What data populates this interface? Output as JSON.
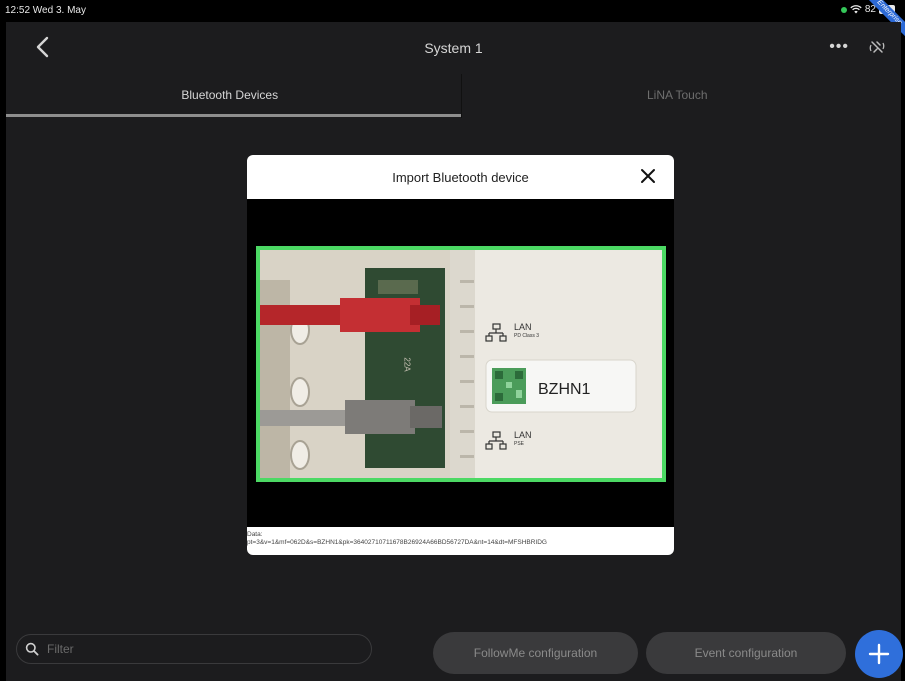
{
  "status_bar": {
    "time": "12:52  Wed 3. May",
    "battery_percent": "82",
    "ribbon_text": "Enterprise"
  },
  "nav": {
    "title": "System 1",
    "more_label": "•••"
  },
  "tabs": [
    {
      "label": "Bluetooth Devices",
      "active": true
    },
    {
      "label": "LiNA Touch",
      "active": false
    }
  ],
  "dialog": {
    "title": "Import Bluetooth device",
    "close_label": "✕",
    "scan_data_label": "Data:",
    "scan_data_value": "pt=3&v=1&mf=062D&s=BZHN1&pk=36402710711678B26924A66BD56727DA&nt=14&dt=MFSHBRIDG",
    "device_label_text": "BZHN1",
    "port_lan_top": "LAN",
    "port_lan_top_sub": "PD Class 3",
    "port_lan_bottom": "LAN",
    "port_lan_bottom_sub": "PSE",
    "port_side_mark": "22A"
  },
  "bottom_bar": {
    "filter_placeholder": "Filter",
    "followme_label": "FollowMe configuration",
    "event_label": "Event configuration",
    "fab_label": "+"
  },
  "colors": {
    "accent": "#2f6fdb",
    "scan_frame": "#4cd964",
    "background": "#1c1c1e"
  }
}
